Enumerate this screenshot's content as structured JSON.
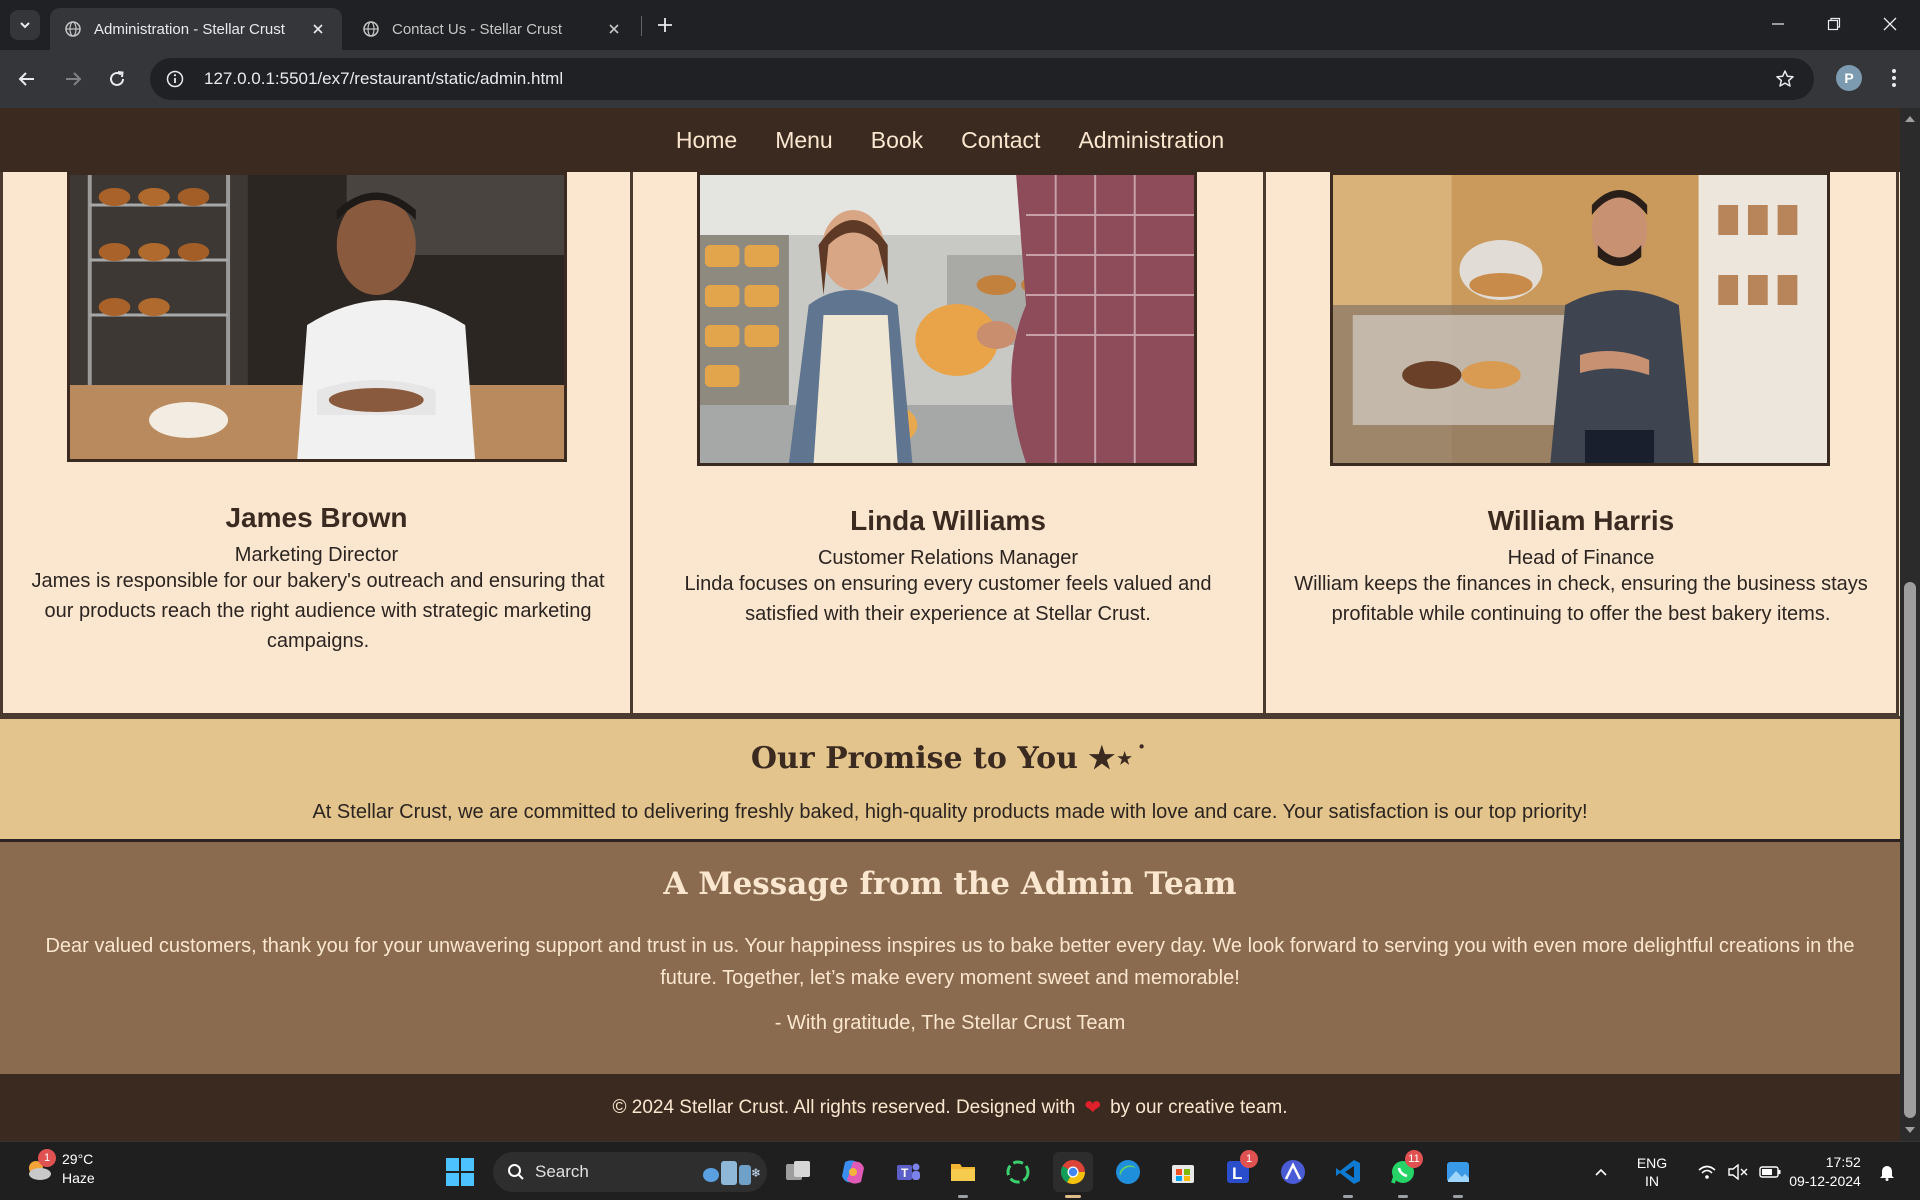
{
  "browser": {
    "tabs": [
      {
        "title": "Administration - Stellar Crust",
        "active": true
      },
      {
        "title": "Contact Us - Stellar Crust",
        "active": false
      }
    ],
    "url": "127.0.0.1:5501/ex7/restaurant/static/admin.html",
    "profile_initial": "P"
  },
  "site": {
    "nav": [
      "Home",
      "Menu",
      "Book",
      "Contact",
      "Administration"
    ],
    "team": [
      {
        "name": "James Brown",
        "role": "Marketing Director",
        "bio": "James is responsible for our bakery's outreach and ensuring that our products reach the right audience with strategic marketing campaigns."
      },
      {
        "name": "Linda Williams",
        "role": "Customer Relations Manager",
        "bio": "Linda focuses on ensuring every customer feels valued and satisfied with their experience at Stellar Crust."
      },
      {
        "name": "William Harris",
        "role": "Head of Finance",
        "bio": "William keeps the finances in check, ensuring the business stays profitable while continuing to offer the best bakery items."
      }
    ],
    "promise": {
      "title": "Our Promise to You ★⋆˙",
      "text": "At Stellar Crust, we are committed to delivering freshly baked, high-quality products made with love and care. Your satisfaction is our top priority!"
    },
    "admin_message": {
      "title": "A Message from the Admin Team",
      "body": "Dear valued customers, thank you for your unwavering support and trust in us. Your happiness inspires us to bake better every day. We look forward to serving you with even more delightful creations in the future. Together, let’s make every moment sweet and memorable!",
      "signoff": "- With gratitude, The Stellar Crust Team"
    },
    "footer": {
      "before": "© 2024 Stellar Crust. All rights reserved. Designed with",
      "heart": "❤",
      "after": "by our creative team."
    }
  },
  "taskbar": {
    "weather": {
      "temp": "29°C",
      "condition": "Haze",
      "badge": "1"
    },
    "search_label": "Search",
    "apps": [
      {
        "name": "task-view-icon"
      },
      {
        "name": "copilot-icon"
      },
      {
        "name": "teams-icon"
      },
      {
        "name": "file-explorer-icon"
      },
      {
        "name": "sync-app-icon"
      },
      {
        "name": "chrome-icon"
      },
      {
        "name": "edge-icon"
      },
      {
        "name": "store-icon"
      },
      {
        "name": "l-app-icon",
        "badge": "1"
      },
      {
        "name": "a-app-icon"
      },
      {
        "name": "vscode-icon"
      },
      {
        "name": "whatsapp-icon",
        "badge": "11"
      },
      {
        "name": "photos-icon"
      }
    ],
    "language": {
      "line1": "ENG",
      "line2": "IN"
    },
    "time": "17:52",
    "date": "09-12-2024"
  },
  "colors": {
    "nav_bg": "#3b2a20",
    "card_bg": "#fbe7d0",
    "promise_bg": "#e2c48c",
    "admin_bg": "#8b6b4f",
    "heart": "#e0202a"
  }
}
